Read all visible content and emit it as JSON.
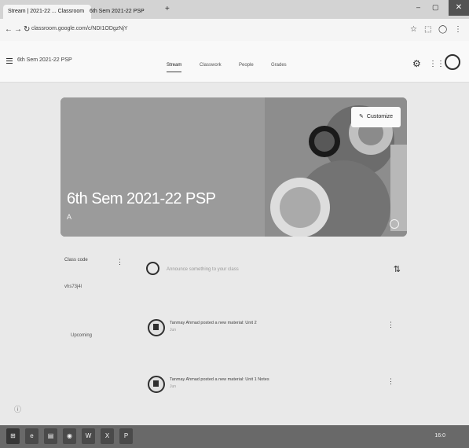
{
  "browser": {
    "tabs": [
      {
        "label": "Stream | 2021-22 ... Classroom",
        "active": true
      },
      {
        "label": "6th Sem 2021-22 PSP",
        "active": false
      }
    ],
    "new_tab": "+",
    "url": "classroom.google.com/c/NDI1ODgzNjY",
    "close": "✕"
  },
  "classroom": {
    "title": "6th Sem 2021-22 PSP",
    "tabs": [
      "Stream",
      "Classwork",
      "People",
      "Grades"
    ]
  },
  "banner": {
    "title": "6th Sem 2021-22 PSP",
    "subtitle": "A",
    "customize_label": "Customize"
  },
  "sidebar": {
    "title": "Class code",
    "code": "vhs73j4l",
    "upcoming_label": "Upcoming"
  },
  "stream": {
    "announce_placeholder": "Announce something to your class",
    "posts": [
      {
        "title": "Tanmay Ahmad posted a new material: Unit 2",
        "date": "Jun"
      },
      {
        "title": "Tanmay Ahmad posted a new material: Unit 1 Notes",
        "date": "Jun"
      }
    ]
  },
  "taskbar": {
    "time": "16:0"
  }
}
